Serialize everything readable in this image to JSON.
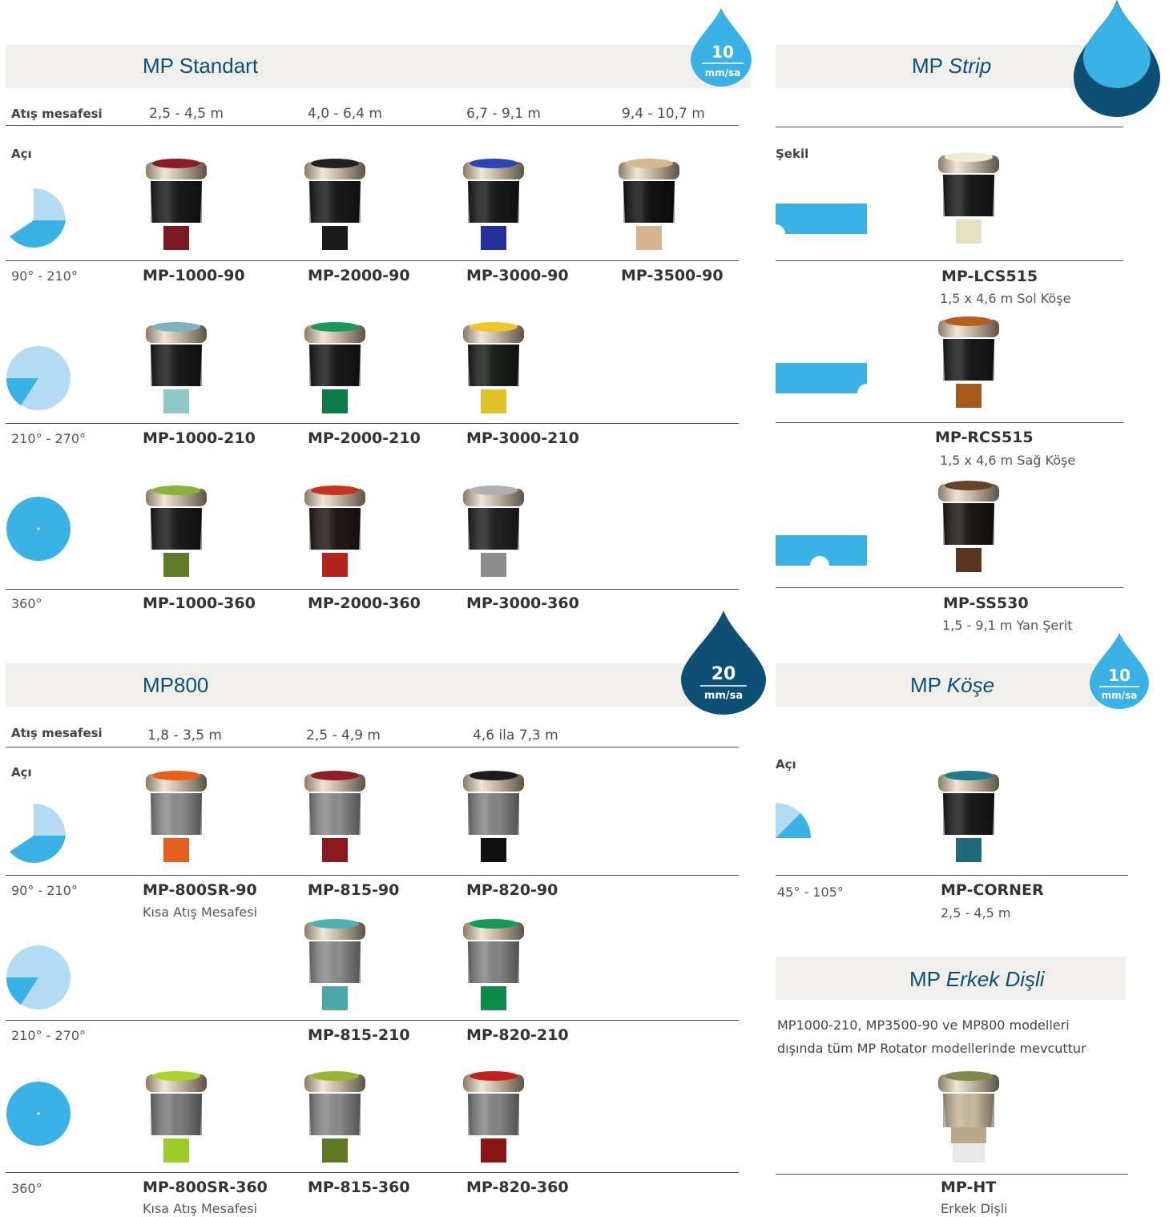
{
  "colors": {
    "accent_blue": "#3bb2e6",
    "light_blue": "#b3dcf3",
    "dark_blue": "#0d4f75",
    "bar_bg": "#f0efec"
  },
  "std": {
    "title_bold": "MP Standart",
    "drop_value": "10",
    "drop_unit": "mm/sa",
    "range_label": "Atış mesafesi",
    "ranges": [
      "2,5 - 4,5 m",
      "4,0 - 6,4 m",
      "6,7 - 9,1 m",
      "9,4 - 10,7 m"
    ],
    "angle_label": "Açı",
    "rows": [
      {
        "angle": "90° - 210°",
        "models": [
          "MP-1000-90",
          "MP-2000-90",
          "MP-3000-90",
          "MP-3500-90"
        ]
      },
      {
        "angle": "210° - 270°",
        "models": [
          "MP-1000-210",
          "MP-2000-210",
          "MP-3000-210"
        ]
      },
      {
        "angle": "360°",
        "models": [
          "MP-1000-360",
          "MP-2000-360",
          "MP-3000-360"
        ]
      }
    ]
  },
  "mp800": {
    "title_bold": "MP800",
    "drop_value": "20",
    "drop_unit": "mm/sa",
    "range_label": "Atış mesafesi",
    "ranges": [
      "1,8 - 3,5 m",
      "2,5 - 4,9 m",
      "4,6 ila 7,3 m"
    ],
    "angle_label": "Açı",
    "rows": [
      {
        "angle": "90° - 210°",
        "models": [
          "MP-800SR-90",
          "MP-815-90",
          "MP-820-90"
        ],
        "sub": "Kısa Atış Mesafesi"
      },
      {
        "angle": "210° - 270°",
        "models": [
          "MP-815-210",
          "MP-820-210"
        ]
      },
      {
        "angle": "360°",
        "models": [
          "MP-800SR-360",
          "MP-815-360",
          "MP-820-360"
        ],
        "sub": "Kısa Atış Mesafesi"
      }
    ]
  },
  "strip": {
    "title_bold": "MP",
    "title_italic": "Strip",
    "shape_label": "Şekil",
    "items": [
      {
        "model": "MP-LCS515",
        "sub": "1,5 x 4,6 m Sol Köşe"
      },
      {
        "model": "MP-RCS515",
        "sub": "1,5 x 4,6 m Sağ Köşe"
      },
      {
        "model": "MP-SS530",
        "sub": "1,5 - 9,1 m Yan Şerit"
      }
    ]
  },
  "corner": {
    "title_bold": "MP",
    "title_italic": "Köşe",
    "drop_value": "10",
    "drop_unit": "mm/sa",
    "angle_label": "Açı",
    "angle": "45° - 105°",
    "model": "MP-CORNER",
    "sub": "2,5 - 4,5 m"
  },
  "male": {
    "title_bold": "MP",
    "title_italic": "Erkek Dişli",
    "desc_line1": "MP1000-210, MP3500-90 ve MP800 modelleri",
    "desc_line2": "dışında tüm MP Rotator modellerinde mevcuttur",
    "model": "MP-HT",
    "sub": "Erkek Dişli"
  }
}
